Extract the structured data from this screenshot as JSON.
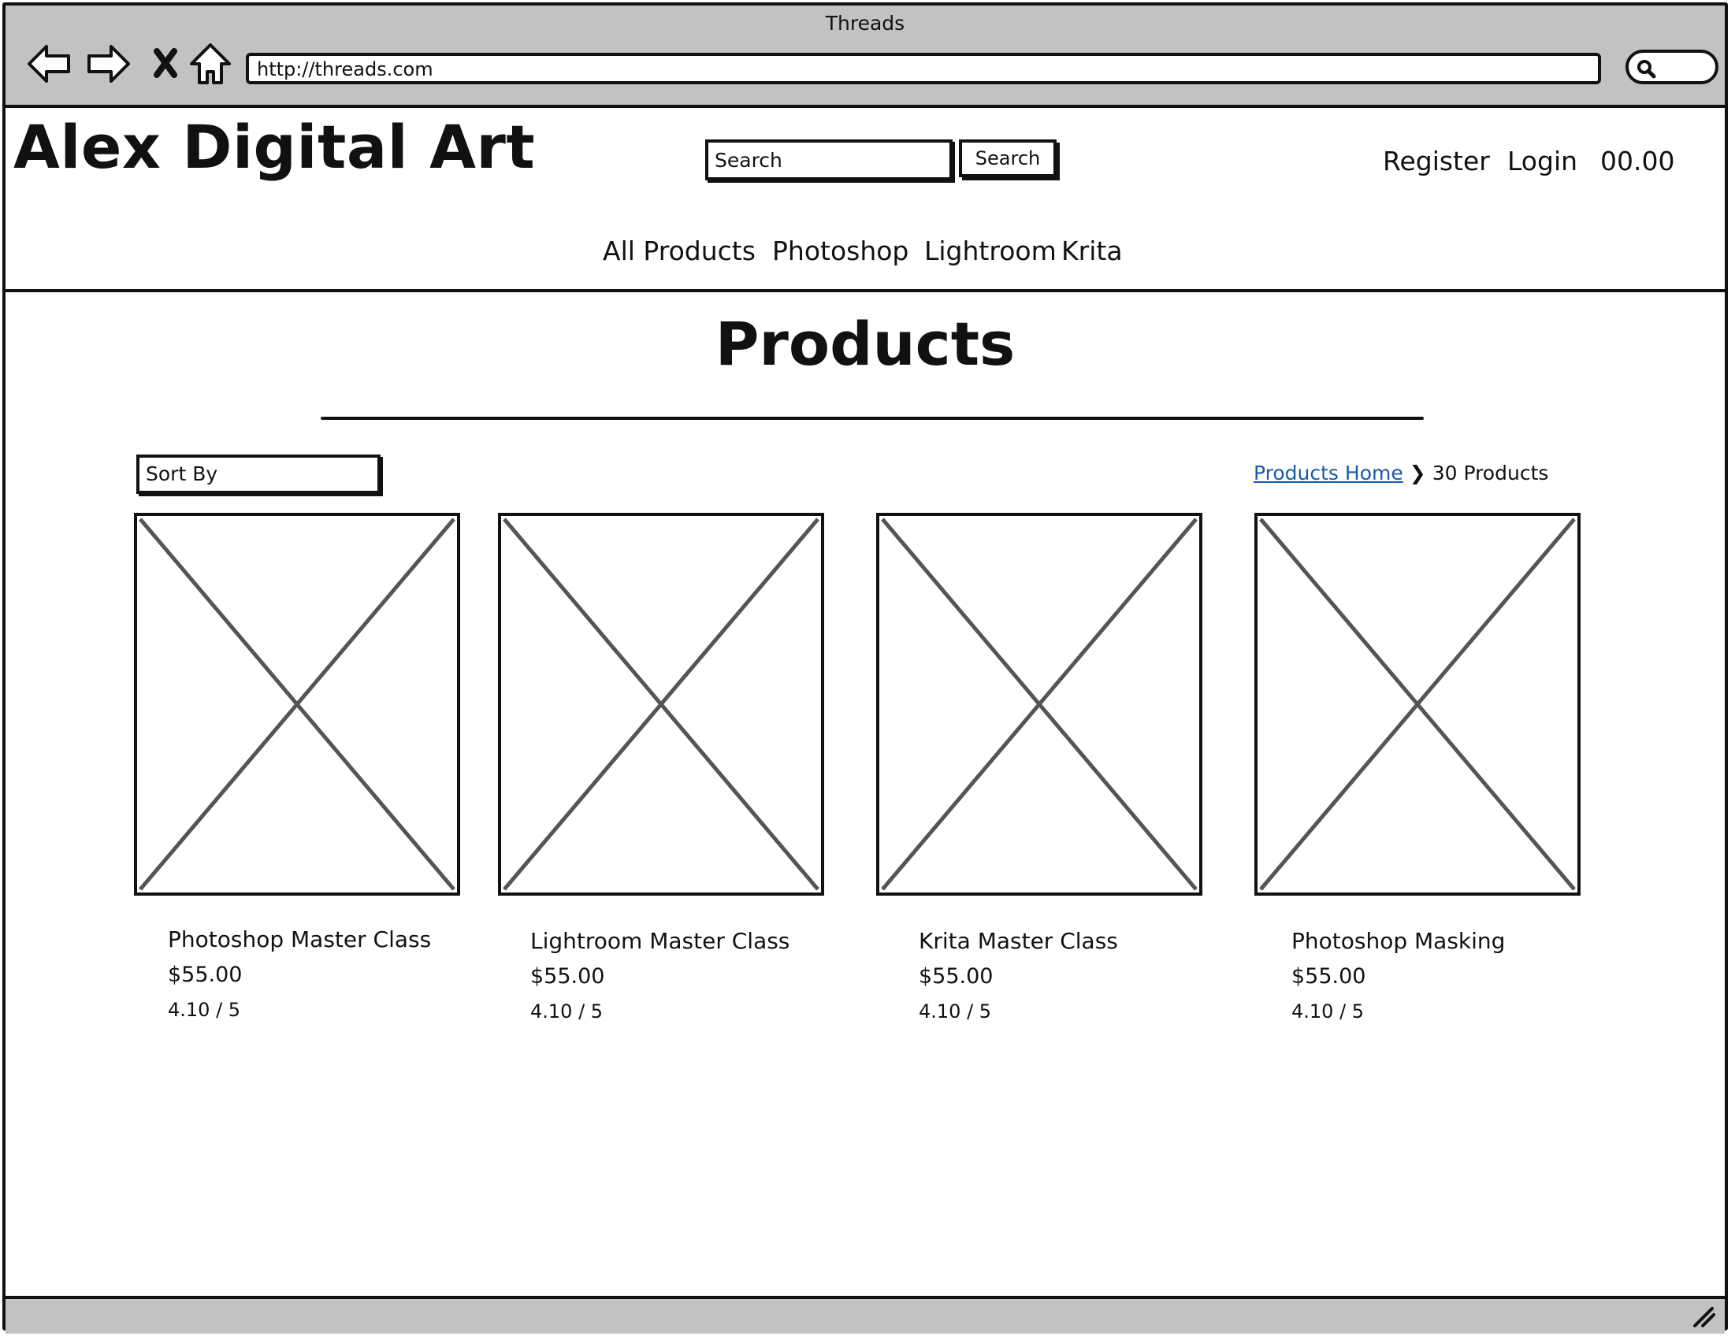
{
  "browser": {
    "window_title": "Threads",
    "url": "http://threads.com",
    "buttons": [
      "back-arrow-icon",
      "forward-arrow-icon",
      "stop-x-icon",
      "home-icon"
    ]
  },
  "header": {
    "site_title": "Alex Digital Art",
    "search_placeholder": "Search",
    "search_button": "Search",
    "register": "Register",
    "login": "Login",
    "cart_total": "00.00"
  },
  "nav": {
    "items": [
      {
        "label": "All Products"
      },
      {
        "label": "Photoshop"
      },
      {
        "label": "Lightroom"
      },
      {
        "label": "Krita"
      }
    ]
  },
  "main": {
    "title": "Products",
    "sort_label": "Sort By",
    "breadcrumb": {
      "home_label": "Products Home",
      "separator": "❯",
      "current": "30 Products"
    },
    "products": [
      {
        "name": "Photoshop Master Class",
        "price": "$55.00",
        "rating": "4.10 / 5"
      },
      {
        "name": "Lightroom Master Class",
        "price": "$55.00",
        "rating": "4.10 / 5"
      },
      {
        "name": "Krita Master Class",
        "price": "$55.00",
        "rating": "4.10 / 5"
      },
      {
        "name": "Photoshop Masking",
        "price": "$55.00",
        "rating": "4.10 / 5"
      }
    ]
  },
  "colors": {
    "chrome_gray": "#c2c2c2",
    "ink": "#111111",
    "link_blue": "#1a5aa8",
    "placeholder_x": "#555555"
  }
}
